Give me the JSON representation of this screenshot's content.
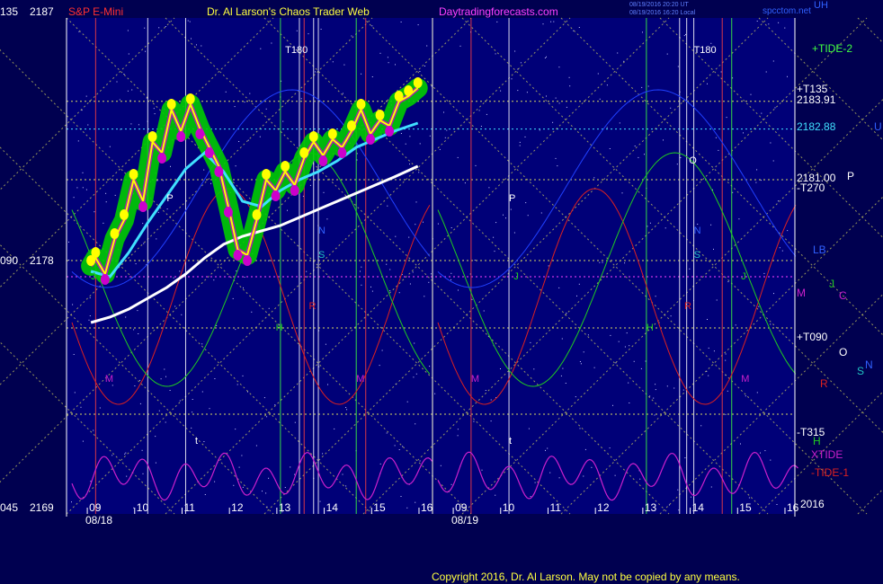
{
  "header": {
    "scale_left": "135",
    "scale_right": "2187",
    "symbol": "S&P E-Mini",
    "title": "Dr. Al Larson's Chaos Trader Web",
    "site": "Daytradingforecasts.com",
    "stamp_1": "08/19/2016 20:20 UT",
    "stamp_2": "08/19/2016 16:20 Local",
    "site_small": "spcctom.net",
    "corner": "UH"
  },
  "footer": {
    "copyright": "Copyright 2016, Dr. Al Larson. May not be copied by any means."
  },
  "colors": {
    "background": "#000050",
    "plot_bg": "#000078",
    "yellow_lines": "#d8d860",
    "price_green": "#00cc00",
    "price_yellow": "#ffff00",
    "price_magenta": "#cc00cc",
    "cyan_ma": "#40e0ff",
    "white_ma": "#ffffff",
    "red_flux": "#dd2020",
    "green_flux": "#20cc20",
    "xtide": "#cc20cc"
  },
  "chart_data": {
    "type": "line",
    "title": "S&P E-Mini",
    "y_axis_left": [
      {
        "value": 2187,
        "scale": "135",
        "label": "2187"
      },
      {
        "value": 2178,
        "scale": "090",
        "label": "2178"
      },
      {
        "value": 2169,
        "scale": "045",
        "label": "2169"
      }
    ],
    "ylim": [
      2169,
      2187
    ],
    "days": [
      {
        "date": "08/18",
        "hours": [
          "09",
          "10",
          "11",
          "12",
          "13",
          "14",
          "15",
          "16"
        ]
      },
      {
        "date": "08/19",
        "hours": [
          "09",
          "10",
          "11",
          "12",
          "13",
          "14",
          "15",
          "16"
        ]
      }
    ],
    "price_levels": [
      {
        "label": "+TIDE-2",
        "color": "#40ff40"
      },
      {
        "label": "+T135",
        "color": "#ffffff"
      },
      {
        "label": "2183.91",
        "value": 2183.91,
        "color": "#ffffff"
      },
      {
        "label": "2182.88",
        "value": 2182.88,
        "color": "#40e0ff"
      },
      {
        "label": "U",
        "color": "#3060ff"
      },
      {
        "label": "2181.00",
        "value": 2181.0,
        "color": "#ffffff"
      },
      {
        "label": "P",
        "color": "#ffffff"
      },
      {
        "label": "-T270",
        "color": "#ffffff"
      },
      {
        "label": "LB",
        "color": "#3060ff"
      },
      {
        "label": "J",
        "color": "#20cc20"
      },
      {
        "label": "M",
        "color": "#cc20cc"
      },
      {
        "label": "C",
        "color": "#cc20cc"
      },
      {
        "label": "+T090",
        "color": "#ffffff"
      },
      {
        "label": "O",
        "color": "#ffffff"
      },
      {
        "label": "S",
        "color": "#20c0c0"
      },
      {
        "label": "N",
        "color": "#3060ff"
      },
      {
        "label": "R",
        "color": "#dd2020"
      },
      {
        "label": "-T315",
        "color": "#ffffff"
      },
      {
        "label": "H",
        "color": "#20cc20"
      },
      {
        "label": "XTIDE",
        "color": "#cc20cc"
      },
      {
        "label": "-TIDE-1",
        "color": "#dd2020"
      },
      {
        "label": "2016",
        "color": "#ffffff"
      }
    ],
    "in_plot_labels": [
      {
        "text": "T180",
        "day": 0,
        "hour": 13.1,
        "value": 2185.7,
        "color": "#ffffff"
      },
      {
        "text": "T180",
        "day": 1,
        "hour": 14.0,
        "value": 2185.7,
        "color": "#ffffff"
      },
      {
        "text": "J",
        "day": 0,
        "hour": 9.0,
        "value": 2177.3,
        "color": "#20cc20"
      },
      {
        "text": "J",
        "day": 1,
        "hour": 10.2,
        "value": 2177.3,
        "color": "#20cc20"
      },
      {
        "text": "J",
        "day": 1,
        "hour": 15.0,
        "value": 2177.3,
        "color": "#20cc20"
      },
      {
        "text": "P",
        "day": 0,
        "hour": 10.6,
        "value": 2180.2,
        "color": "#ffffff"
      },
      {
        "text": "P",
        "day": 1,
        "hour": 10.1,
        "value": 2180.2,
        "color": "#ffffff"
      },
      {
        "text": "O",
        "day": 1,
        "hour": 13.9,
        "value": 2181.6,
        "color": "#ffffff"
      },
      {
        "text": "N",
        "day": 0,
        "hour": 13.8,
        "value": 2179.0,
        "color": "#3060ff"
      },
      {
        "text": "N",
        "day": 1,
        "hour": 14.0,
        "value": 2179.0,
        "color": "#3060ff"
      },
      {
        "text": "S",
        "day": 0,
        "hour": 13.8,
        "value": 2178.1,
        "color": "#20c0c0"
      },
      {
        "text": "S",
        "day": 1,
        "hour": 14.0,
        "value": 2178.1,
        "color": "#20c0c0"
      },
      {
        "text": "R",
        "day": 0,
        "hour": 13.6,
        "value": 2176.2,
        "color": "#dd2020"
      },
      {
        "text": "R",
        "day": 1,
        "hour": 13.8,
        "value": 2176.2,
        "color": "#dd2020"
      },
      {
        "text": "H",
        "day": 0,
        "hour": 12.9,
        "value": 2175.4,
        "color": "#20cc20"
      },
      {
        "text": "H",
        "day": 1,
        "hour": 13.0,
        "value": 2175.4,
        "color": "#20cc20"
      },
      {
        "text": "M",
        "day": 0,
        "hour": 9.3,
        "value": 2173.5,
        "color": "#cc20cc"
      },
      {
        "text": "M",
        "day": 0,
        "hour": 14.6,
        "value": 2173.5,
        "color": "#cc20cc"
      },
      {
        "text": "M",
        "day": 1,
        "hour": 9.3,
        "value": 2173.5,
        "color": "#cc20cc"
      },
      {
        "text": "M",
        "day": 1,
        "hour": 15.0,
        "value": 2173.5,
        "color": "#cc20cc"
      },
      {
        "text": "t",
        "day": 0,
        "hour": 11.2,
        "value": 2171.2,
        "color": "#ffffff"
      },
      {
        "text": "t",
        "day": 1,
        "hour": 10.1,
        "value": 2171.2,
        "color": "#ffffff"
      }
    ],
    "price_series": {
      "name": "S&P E-Mini",
      "x_hours": [
        9.0,
        9.1,
        9.3,
        9.5,
        9.7,
        9.9,
        10.1,
        10.3,
        10.5,
        10.7,
        10.9,
        11.1,
        11.3,
        11.5,
        11.7,
        11.9,
        12.1,
        12.3,
        12.5,
        12.7,
        12.9,
        13.1,
        13.3,
        13.5,
        13.7,
        13.9,
        14.1,
        14.3,
        14.5,
        14.7,
        14.9,
        15.1,
        15.3,
        15.5,
        15.7,
        15.9
      ],
      "values": [
        2177.8,
        2178.1,
        2177.5,
        2178.8,
        2179.5,
        2181.0,
        2180.2,
        2182.4,
        2182.0,
        2183.6,
        2182.8,
        2183.8,
        2182.9,
        2182.2,
        2181.5,
        2180.0,
        2178.4,
        2178.2,
        2179.5,
        2181.0,
        2180.6,
        2181.3,
        2180.8,
        2181.8,
        2182.4,
        2181.9,
        2182.5,
        2182.2,
        2182.8,
        2183.6,
        2182.7,
        2183.2,
        2183.0,
        2183.9,
        2184.1,
        2184.4
      ]
    },
    "ma_cyan": {
      "x_hours": [
        9.0,
        9.4,
        9.8,
        10.2,
        10.6,
        11.0,
        11.4,
        11.8,
        12.2,
        12.6,
        13.0,
        13.4,
        13.8,
        14.2,
        14.6,
        15.0,
        15.4,
        15.9
      ],
      "values": [
        2177.6,
        2177.4,
        2178.3,
        2179.4,
        2180.4,
        2181.4,
        2182.0,
        2181.3,
        2180.2,
        2180.0,
        2180.6,
        2181.0,
        2181.3,
        2181.7,
        2182.2,
        2182.5,
        2182.8,
        2183.1
      ]
    },
    "ma_white": {
      "x_hours": [
        9.0,
        9.4,
        9.8,
        10.2,
        10.6,
        11.0,
        11.4,
        11.8,
        12.2,
        12.6,
        13.0,
        13.4,
        13.8,
        14.2,
        14.6,
        15.0,
        15.4,
        15.9
      ],
      "values": [
        2175.7,
        2175.9,
        2176.2,
        2176.6,
        2177.0,
        2177.5,
        2178.1,
        2178.6,
        2178.9,
        2179.1,
        2179.3,
        2179.6,
        2179.9,
        2180.2,
        2180.5,
        2180.8,
        2181.1,
        2181.5
      ]
    }
  }
}
